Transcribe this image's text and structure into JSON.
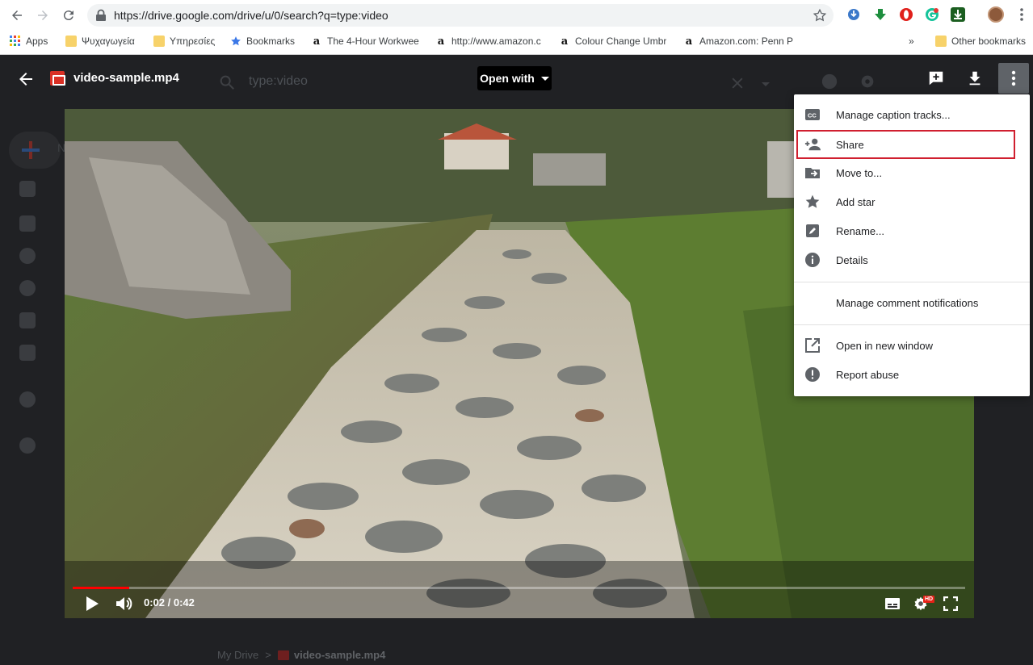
{
  "browser": {
    "url": "https://drive.google.com/drive/u/0/search?q=type:video",
    "bookmarks": [
      {
        "label": "Apps",
        "icon": "apps-grid-icon"
      },
      {
        "label": "Ψυχαγωγεία",
        "icon": "folder-icon"
      },
      {
        "label": "Υπηρεσίες",
        "icon": "folder-icon"
      },
      {
        "label": "Bookmarks",
        "icon": "star-icon"
      },
      {
        "label": "The 4-Hour Workwee",
        "icon": "amazon-icon"
      },
      {
        "label": "http://www.amazon.c",
        "icon": "amazon-icon"
      },
      {
        "label": "Colour Change Umbr",
        "icon": "amazon-icon"
      },
      {
        "label": "Amazon.com: Penn P",
        "icon": "amazon-icon"
      }
    ],
    "more_bookmarks": "»",
    "other_bookmarks": "Other bookmarks"
  },
  "drive_background": {
    "search_query": "type:video",
    "breadcrumb": {
      "root": "My Drive",
      "separator": ">",
      "file": "video-sample.mp4"
    }
  },
  "viewer": {
    "file_name": "video-sample.mp4",
    "open_with_label": "Open with",
    "header_icons": [
      "add-comment-icon",
      "download-icon",
      "more-vert-icon"
    ]
  },
  "player": {
    "current_time": "0:02",
    "duration": "0:42",
    "time_display": "0:02 / 0:42",
    "progress_fraction": 0.063,
    "hd_badge": "HD"
  },
  "menu": {
    "items": [
      {
        "label": "Manage caption tracks...",
        "icon": "closed-caption-icon"
      },
      {
        "label": "Share",
        "icon": "person-add-icon",
        "highlighted": true
      },
      {
        "label": "Move to...",
        "icon": "move-to-folder-icon"
      },
      {
        "label": "Add star",
        "icon": "star-icon"
      },
      {
        "label": "Rename...",
        "icon": "pencil-icon"
      },
      {
        "label": "Details",
        "icon": "info-icon"
      },
      {
        "label": "Manage comment notifications",
        "icon": ""
      },
      {
        "label": "Open in new window",
        "icon": "open-in-new-icon"
      },
      {
        "label": "Report abuse",
        "icon": "report-icon"
      }
    ]
  },
  "colors": {
    "highlight_outline": "#d01f2f",
    "progress_played": "#ff0000",
    "viewer_background": "#202124"
  }
}
